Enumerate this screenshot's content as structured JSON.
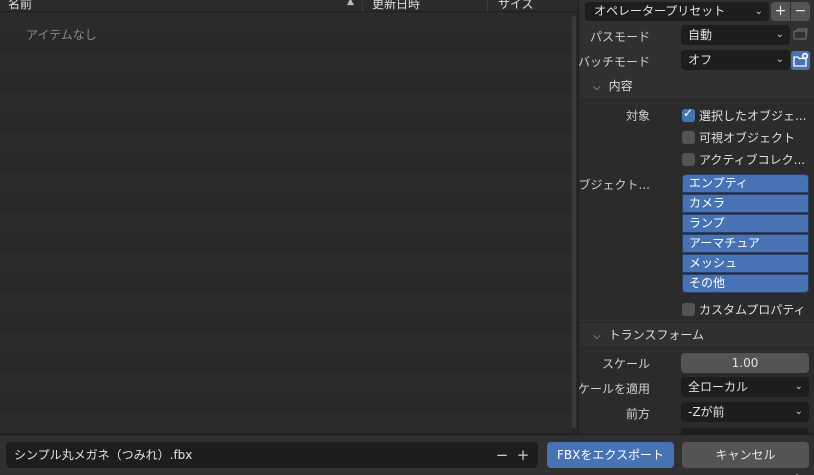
{
  "file_list": {
    "columns": {
      "name": "名前",
      "modified": "更新日時",
      "size": "サイズ"
    },
    "empty_text": "アイテムなし"
  },
  "sidebar": {
    "operator_preset": {
      "label": "オペレータープリセット",
      "add": "+",
      "remove": "−"
    },
    "path_mode": {
      "label": "パスモード",
      "value": "自動"
    },
    "batch_mode": {
      "label": "バッチモード",
      "value": "オフ"
    },
    "include_panel": {
      "title": "内容",
      "target_label": "対象",
      "checkboxes": [
        {
          "label": "選択したオブジェ...",
          "checked": true
        },
        {
          "label": "可視オブジェクト",
          "checked": false
        },
        {
          "label": "アクティブコレク...",
          "checked": false
        }
      ],
      "object_types_label": "オブジェクト...",
      "object_types": [
        "エンプティ",
        "カメラ",
        "ランプ",
        "アーマチュア",
        "メッシュ",
        "その他"
      ],
      "custom_props": {
        "label": "カスタムプロパティ",
        "checked": false
      }
    },
    "transform_panel": {
      "title": "トランスフォーム",
      "scale": {
        "label": "スケール",
        "value": "1.00"
      },
      "apply_scale": {
        "label": "スケールを適用",
        "value": "全ローカル"
      },
      "forward": {
        "label": "前方",
        "value": "-Zが前"
      }
    }
  },
  "bottom_bar": {
    "filename": "シンプル丸メガネ（つみれ）.fbx",
    "decrement": "−",
    "increment": "+",
    "export_label": "FBXをエクスポート",
    "cancel_label": "キャンセル"
  },
  "colors": {
    "accent": "#4772b3",
    "panel": "#303030",
    "field": "#1d1d1d",
    "list_bg": "#282828"
  }
}
